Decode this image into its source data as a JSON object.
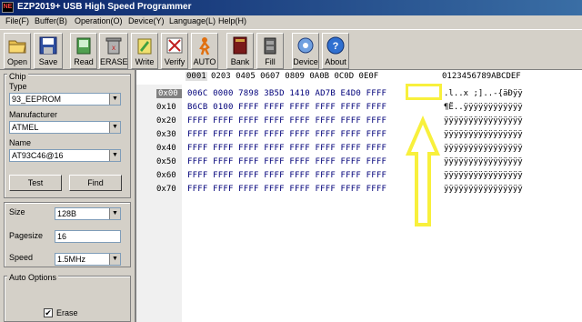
{
  "window": {
    "title": "EZP2019+ USB High Speed Programmer",
    "icon_text": "NE"
  },
  "menu": {
    "items": [
      "File(F)",
      "Buffer(B)",
      "Operation(O)",
      "Device(Y)",
      "Language(L)",
      "Help(H)"
    ]
  },
  "toolbar": {
    "open": "Open",
    "save": "Save",
    "read": "Read",
    "erase": "ERASE",
    "write": "Write",
    "verify": "Verify",
    "auto": "AUTO",
    "bank": "Bank",
    "fill": "Fill",
    "device": "Device",
    "about": "About"
  },
  "chip": {
    "group_label": "Chip",
    "type_label": "Type",
    "type_value": "93_EEPROM",
    "manufacturer_label": "Manufacturer",
    "manufacturer_value": "ATMEL",
    "name_label": "Name",
    "name_value": "AT93C46@16",
    "test_button": "Test",
    "find_button": "Find"
  },
  "params": {
    "size_label": "Size",
    "size_value": "128B",
    "pagesize_label": "Pagesize",
    "pagesize_value": "16",
    "speed_label": "Speed",
    "speed_value": "1.5MHz"
  },
  "auto_options": {
    "group_label": "Auto Options",
    "erase_label": "Erase",
    "erase_checked": true
  },
  "hex": {
    "header_first": "0001",
    "header_rest": "0203 0405 0607 0809 0A0B 0C0D 0E0F",
    "ascii_header": "0123456789ABCDEF",
    "rows": [
      {
        "addr": "0x00",
        "hex": "006C 0000 7898 3B5D 1410 AD7B E4D0 FFFF",
        "ascii": ".l..x ;]..-{äÐÿÿ"
      },
      {
        "addr": "0x10",
        "hex": "B6CB 0100 FFFF FFFF FFFF FFFF FFFF FFFF",
        "ascii": "¶Ë..ÿÿÿÿÿÿÿÿÿÿÿÿ"
      },
      {
        "addr": "0x20",
        "hex": "FFFF FFFF FFFF FFFF FFFF FFFF FFFF FFFF",
        "ascii": "ÿÿÿÿÿÿÿÿÿÿÿÿÿÿÿÿ"
      },
      {
        "addr": "0x30",
        "hex": "FFFF FFFF FFFF FFFF FFFF FFFF FFFF FFFF",
        "ascii": "ÿÿÿÿÿÿÿÿÿÿÿÿÿÿÿÿ"
      },
      {
        "addr": "0x40",
        "hex": "FFFF FFFF FFFF FFFF FFFF FFFF FFFF FFFF",
        "ascii": "ÿÿÿÿÿÿÿÿÿÿÿÿÿÿÿÿ"
      },
      {
        "addr": "0x50",
        "hex": "FFFF FFFF FFFF FFFF FFFF FFFF FFFF FFFF",
        "ascii": "ÿÿÿÿÿÿÿÿÿÿÿÿÿÿÿÿ"
      },
      {
        "addr": "0x60",
        "hex": "FFFF FFFF FFFF FFFF FFFF FFFF FFFF FFFF",
        "ascii": "ÿÿÿÿÿÿÿÿÿÿÿÿÿÿÿÿ"
      },
      {
        "addr": "0x70",
        "hex": "FFFF FFFF FFFF FFFF FFFF FFFF FFFF FFFF",
        "ascii": "ÿÿÿÿÿÿÿÿÿÿÿÿÿÿÿÿ"
      }
    ]
  },
  "colors": {
    "annotation": "#f8f03c",
    "hex_text": "#00007a",
    "titlebar": "#0a246a"
  }
}
